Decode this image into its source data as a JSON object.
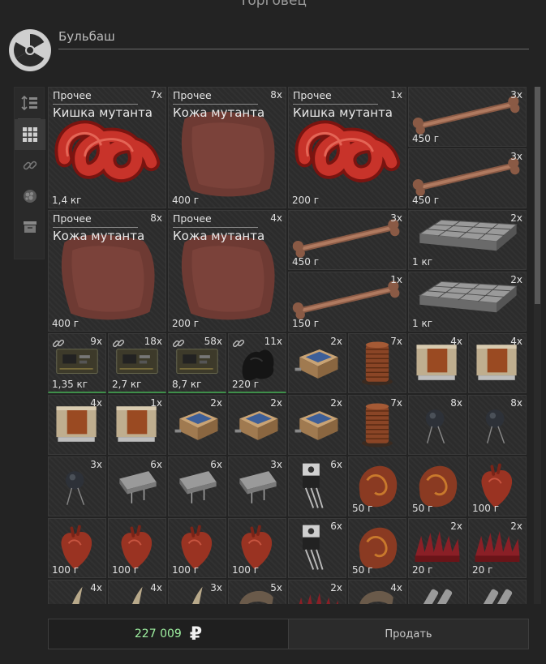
{
  "window": {
    "title": "Торговец"
  },
  "trader": {
    "name": "Бульбаш",
    "logo_icon": "radiation-icon"
  },
  "toolbar": {
    "buttons": [
      {
        "icon": "sort-icon"
      },
      {
        "icon": "grid-icon"
      },
      {
        "icon": "link-icon"
      },
      {
        "icon": "artifact-icon"
      },
      {
        "icon": "box-icon"
      }
    ]
  },
  "items": [
    {
      "category": "Прочее",
      "name": "Кишка мутанта",
      "qty": "7x",
      "weight": "1,4 кг",
      "icon": "mutant-gut-icon"
    },
    {
      "category": "Прочее",
      "name": "Кожа мутанта",
      "qty": "8x",
      "weight": "400 г",
      "icon": "mutant-skin-icon"
    },
    {
      "category": "Прочее",
      "name": "Кишка мутанта",
      "qty": "1x",
      "weight": "200 г",
      "icon": "mutant-gut-icon"
    },
    {
      "qty": "3x",
      "weight": "450 г",
      "icon": "bone-icon"
    },
    {
      "qty": "3x",
      "weight": "450 г",
      "icon": "bone-icon"
    },
    {
      "category": "Прочее",
      "name": "Кожа мутанта",
      "qty": "8x",
      "weight": "400 г",
      "icon": "mutant-skin-icon"
    },
    {
      "category": "Прочее",
      "name": "Кожа мутанта",
      "qty": "4x",
      "weight": "200 г",
      "icon": "mutant-skin-icon"
    },
    {
      "qty": "3x",
      "weight": "450 г",
      "icon": "bone-icon"
    },
    {
      "qty": "2x",
      "weight": "1 кг",
      "icon": "mesh-panel-icon"
    },
    {
      "qty": "1x",
      "weight": "150 г",
      "icon": "bone-icon"
    },
    {
      "qty": "2x",
      "weight": "1 кг",
      "icon": "mesh-panel-icon"
    },
    {
      "qty": "9x",
      "weight": "1,35 кг",
      "icon": "circuit-board-icon"
    },
    {
      "qty": "18x",
      "weight": "2,7 кг",
      "icon": "circuit-board-icon"
    },
    {
      "qty": "58x",
      "weight": "8,7 кг",
      "icon": "circuit-board-icon"
    },
    {
      "qty": "11x",
      "weight": "220 г",
      "icon": "coal-icon"
    },
    {
      "qty": "2x",
      "weight": "",
      "icon": "solar-module-icon"
    },
    {
      "qty": "7x",
      "weight": "",
      "icon": "coil-icon"
    },
    {
      "qty": "4x",
      "weight": "",
      "icon": "transformer-icon"
    },
    {
      "qty": "4x",
      "weight": "",
      "icon": "transformer-icon"
    },
    {
      "qty": "4x",
      "weight": "",
      "icon": "transformer-icon"
    },
    {
      "qty": "1x",
      "weight": "",
      "icon": "transformer-icon"
    },
    {
      "qty": "2x",
      "weight": "",
      "icon": "solar-module-icon"
    },
    {
      "qty": "2x",
      "weight": "",
      "icon": "solar-module-icon"
    },
    {
      "qty": "2x",
      "weight": "",
      "icon": "solar-module-icon"
    },
    {
      "qty": "7x",
      "weight": "",
      "icon": "coil-icon"
    },
    {
      "qty": "8x",
      "weight": "",
      "icon": "capacitor-icon"
    },
    {
      "qty": "8x",
      "weight": "",
      "icon": "capacitor-icon"
    },
    {
      "qty": "3x",
      "weight": "",
      "icon": "capacitor-icon"
    },
    {
      "qty": "6x",
      "weight": "",
      "icon": "crystal-icon"
    },
    {
      "qty": "6x",
      "weight": "",
      "icon": "crystal-icon"
    },
    {
      "qty": "3x",
      "weight": "",
      "icon": "crystal-icon"
    },
    {
      "qty": "6x",
      "weight": "",
      "icon": "transistor-icon"
    },
    {
      "qty": "",
      "weight": "50 г",
      "icon": "meat-icon"
    },
    {
      "qty": "",
      "weight": "50 г",
      "icon": "meat-icon"
    },
    {
      "qty": "",
      "weight": "100 г",
      "icon": "heart-icon"
    },
    {
      "qty": "",
      "weight": "100 г",
      "icon": "heart-icon"
    },
    {
      "qty": "",
      "weight": "100 г",
      "icon": "heart-icon"
    },
    {
      "qty": "",
      "weight": "100 г",
      "icon": "heart-icon"
    },
    {
      "qty": "",
      "weight": "100 г",
      "icon": "heart-icon"
    },
    {
      "qty": "6x",
      "weight": "",
      "icon": "transistor-icon"
    },
    {
      "qty": "",
      "weight": "50 г",
      "icon": "meat-icon"
    },
    {
      "qty": "2x",
      "weight": "20 г",
      "icon": "spikes-icon"
    },
    {
      "qty": "2x",
      "weight": "20 г",
      "icon": "spikes-icon"
    },
    {
      "qty": "4x",
      "weight": "",
      "icon": "claw-icon"
    },
    {
      "qty": "4x",
      "weight": "",
      "icon": "claw-icon"
    },
    {
      "qty": "3x",
      "weight": "",
      "icon": "claw-icon"
    },
    {
      "qty": "5x",
      "weight": "",
      "icon": "hoof-icon"
    },
    {
      "qty": "2x",
      "weight": "",
      "icon": "spikes-icon"
    },
    {
      "qty": "4x",
      "weight": "",
      "icon": "hoof-icon"
    },
    {
      "qty": "",
      "weight": "",
      "icon": "tool-icon"
    },
    {
      "qty": "",
      "weight": "",
      "icon": "tool-icon"
    }
  ],
  "footer": {
    "money": "227 009",
    "currency": "₽",
    "sell_label": "Продать"
  },
  "colors": {
    "money": "#9ef0a0",
    "background": "#232323",
    "cell": "#2c2c2c"
  }
}
